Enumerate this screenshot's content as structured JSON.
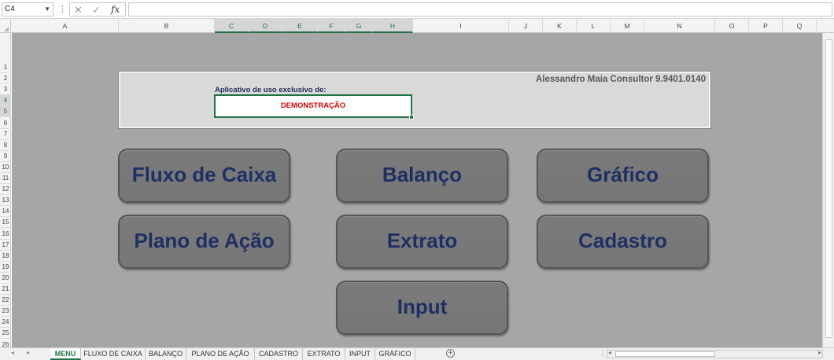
{
  "formula_bar": {
    "name_box": "C4",
    "cancel_icon": "✕",
    "confirm_icon": "✓",
    "fx_label": "fx",
    "formula_value": ""
  },
  "columns": [
    "A",
    "B",
    "C",
    "D",
    "E",
    "F",
    "G",
    "H",
    "I",
    "J",
    "K",
    "L",
    "M",
    "N",
    "O",
    "P",
    "Q"
  ],
  "selected_columns": [
    "C",
    "D",
    "E",
    "F",
    "G",
    "H"
  ],
  "rows": [
    "1",
    "2",
    "3",
    "4",
    "5",
    "6",
    "7",
    "8",
    "9",
    "10",
    "11",
    "12",
    "13",
    "14",
    "15",
    "16",
    "17",
    "18",
    "19",
    "20",
    "21",
    "22",
    "23",
    "24",
    "25",
    "26"
  ],
  "selected_rows": [
    "4",
    "5"
  ],
  "header_panel": {
    "consultant": "Alessandro Maia Consultor   9.9401.0140",
    "exclusive_label": "Aplicativo de uso exclusivo de:",
    "demo_value": "DEMONSTRAÇÃO"
  },
  "menu_buttons": {
    "fluxo_caixa": "Fluxo de Caixa",
    "balanco": "Balanço",
    "grafico": "Gráfico",
    "plano_acao": "Plano de Ação",
    "extrato": "Extrato",
    "cadastro": "Cadastro",
    "input": "Input"
  },
  "sheet_tabs": [
    "MENU",
    "FLUXO DE CAIXA",
    "BALANÇO",
    "PLANO DE AÇÃO",
    "CADASTRO",
    "EXTRATO",
    "INPUT",
    "GRÁFICO"
  ],
  "active_tab": "MENU",
  "colors": {
    "accent": "#217346",
    "sheet_bg": "#a6a6a6",
    "button_bg": "#7b7b7b",
    "button_text": "#1f2f64",
    "demo_text": "#e00000"
  }
}
